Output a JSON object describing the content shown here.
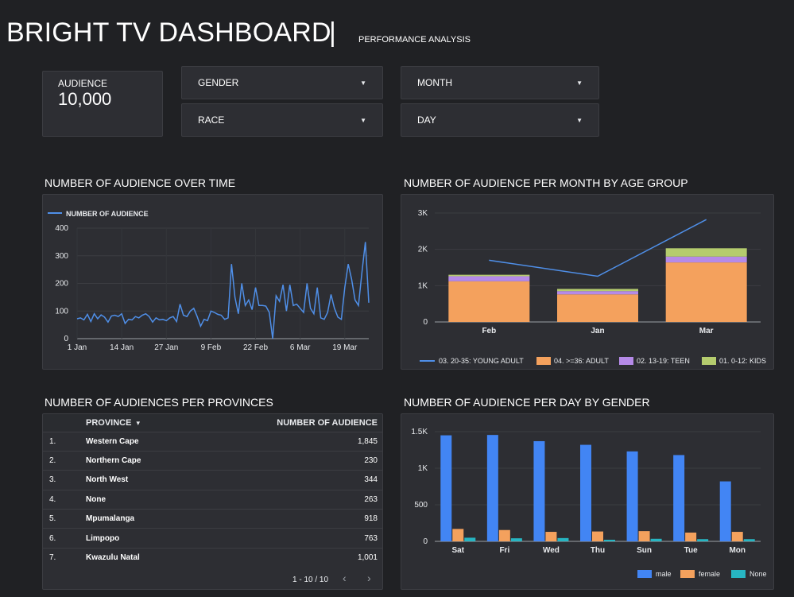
{
  "header": {
    "title": "BRIGHT TV DASHBOARD",
    "separator": "|",
    "subtitle": "PERFORMANCE ANALYSIS"
  },
  "kpi": {
    "label": "AUDIENCE",
    "value": "10,000"
  },
  "filters": {
    "gender": "GENDER",
    "race": "RACE",
    "month": "MONTH",
    "day": "DAY"
  },
  "sections": {
    "over_time": "NUMBER OF AUDIENCE OVER TIME",
    "per_month": "NUMBER OF AUDIENCE PER MONTH BY AGE GROUP",
    "per_province": "NUMBER OF AUDIENCES PER PROVINCES",
    "per_day": "NUMBER OF AUDIENCE PER DAY BY GENDER"
  },
  "table": {
    "col_province": "PROVINCE",
    "col_sort_icon": "▾",
    "col_count": "NUMBER OF AUDIENCE",
    "rows": [
      {
        "idx": "1.",
        "province": "Western Cape",
        "count": "1,845"
      },
      {
        "idx": "2.",
        "province": "Northern Cape",
        "count": "230"
      },
      {
        "idx": "3.",
        "province": "North West",
        "count": "344"
      },
      {
        "idx": "4.",
        "province": "None",
        "count": "263"
      },
      {
        "idx": "5.",
        "province": "Mpumalanga",
        "count": "918"
      },
      {
        "idx": "6.",
        "province": "Limpopo",
        "count": "763"
      },
      {
        "idx": "7.",
        "province": "Kwazulu Natal",
        "count": "1,001"
      }
    ],
    "pager_text": "1 - 10 / 10",
    "prev_icon": "chevron-left-icon",
    "next_icon": "chevron-right-icon"
  },
  "colors": {
    "line_blue": "#4f8fe8",
    "adult": "#f4a15d",
    "teen": "#b58ae8",
    "kids": "#b5cc6e",
    "male": "#4285f4",
    "female": "#f4a15d",
    "none": "#27b5c2"
  },
  "chart_data": [
    {
      "type": "line",
      "legend": [
        "NUMBER OF AUDIENCE"
      ],
      "x_ticks": [
        "1 Jan",
        "14 Jan",
        "27 Jan",
        "9 Feb",
        "22 Feb",
        "6 Mar",
        "19 Mar"
      ],
      "ylim": [
        0,
        400
      ],
      "y_ticks": [
        0,
        100,
        200,
        300,
        400
      ],
      "grid": true,
      "legend_position": "top-left",
      "series": [
        {
          "name": "NUMBER OF AUDIENCE",
          "x_start": "2016-01-01",
          "values": [
            72,
            75,
            68,
            88,
            62,
            90,
            72,
            86,
            78,
            60,
            82,
            85,
            80,
            90,
            55,
            70,
            68,
            80,
            75,
            85,
            90,
            80,
            60,
            75,
            68,
            70,
            65,
            75,
            80,
            62,
            125,
            85,
            80,
            100,
            110,
            80,
            45,
            70,
            65,
            100,
            95,
            88,
            85,
            70,
            75,
            270,
            150,
            90,
            200,
            120,
            140,
            105,
            185,
            120,
            120,
            118,
            95,
            0,
            155,
            135,
            195,
            100,
            195,
            120,
            125,
            110,
            95,
            200,
            110,
            90,
            185,
            75,
            70,
            95,
            160,
            110,
            78,
            70,
            185,
            270,
            215,
            140,
            120,
            240,
            350,
            130
          ]
        }
      ]
    },
    {
      "type": "bar",
      "stacked": true,
      "categories": [
        "Feb",
        "Jan",
        "Mar"
      ],
      "ylim": [
        0,
        3000
      ],
      "y_ticks": [
        "0",
        "1K",
        "2K",
        "3K"
      ],
      "legend_position": "bottom",
      "series": [
        {
          "name": "04. >=36: ADULT",
          "values": [
            1120,
            760,
            1640
          ]
        },
        {
          "name": "02. 13-19: TEEN",
          "values": [
            140,
            90,
            160
          ]
        },
        {
          "name": "01. 0-12: KIDS",
          "values": [
            40,
            60,
            230
          ]
        }
      ],
      "line_series": {
        "name": "03. 20-35: YOUNG ADULT",
        "values": [
          1700,
          1260,
          2820
        ]
      }
    },
    {
      "type": "bar",
      "categories": [
        "Sat",
        "Fri",
        "Wed",
        "Thu",
        "Sun",
        "Tue",
        "Mon"
      ],
      "ylim": [
        0,
        1500
      ],
      "y_ticks": [
        "0",
        "500",
        "1K",
        "1.5K"
      ],
      "legend_position": "bottom-right",
      "series": [
        {
          "name": "male",
          "values": [
            1450,
            1455,
            1370,
            1320,
            1230,
            1180,
            820
          ]
        },
        {
          "name": "female",
          "values": [
            170,
            155,
            130,
            135,
            140,
            120,
            130
          ]
        },
        {
          "name": "None",
          "values": [
            50,
            42,
            45,
            22,
            35,
            30,
            30
          ]
        }
      ]
    }
  ]
}
